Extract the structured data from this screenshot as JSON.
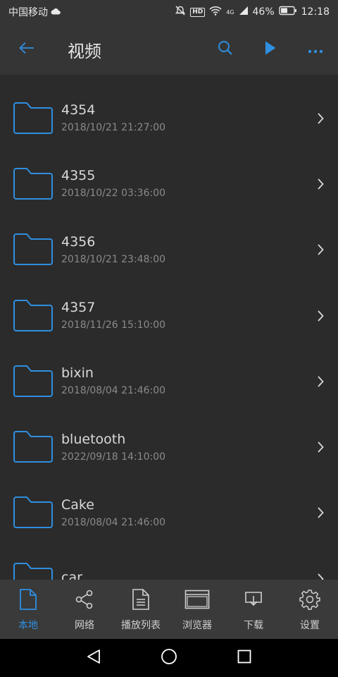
{
  "status": {
    "carrier": "中国移动",
    "network": "4G",
    "battery": "46%",
    "time": "12:18",
    "hd": "HD"
  },
  "header": {
    "title": "视频",
    "icons": [
      "back-arrow-icon",
      "search-icon",
      "play-icon",
      "more-icon"
    ]
  },
  "folders": [
    {
      "name": "4354",
      "date": "2018/10/21 21:27:00"
    },
    {
      "name": "4355",
      "date": "2018/10/22 03:36:00"
    },
    {
      "name": "4356",
      "date": "2018/10/21 23:48:00"
    },
    {
      "name": "4357",
      "date": "2018/11/26 15:10:00"
    },
    {
      "name": "bixin",
      "date": "2018/08/04 21:46:00"
    },
    {
      "name": "bluetooth",
      "date": "2022/09/18 14:10:00"
    },
    {
      "name": "Cake",
      "date": "2018/08/04 21:46:00"
    },
    {
      "name": "car",
      "date": ""
    }
  ],
  "bottom_nav": [
    {
      "label": "本地",
      "icon": "file-icon",
      "active": true
    },
    {
      "label": "网络",
      "icon": "share-icon",
      "active": false
    },
    {
      "label": "播放列表",
      "icon": "playlist-icon",
      "active": false
    },
    {
      "label": "浏览器",
      "icon": "browser-icon",
      "active": false
    },
    {
      "label": "下载",
      "icon": "download-icon",
      "active": false
    },
    {
      "label": "设置",
      "icon": "gear-icon",
      "active": false
    }
  ],
  "colors": {
    "accent": "#2f8fe0",
    "background": "#2b2b2b",
    "bar": "#353535",
    "bottom_nav": "#3a3a3a"
  }
}
